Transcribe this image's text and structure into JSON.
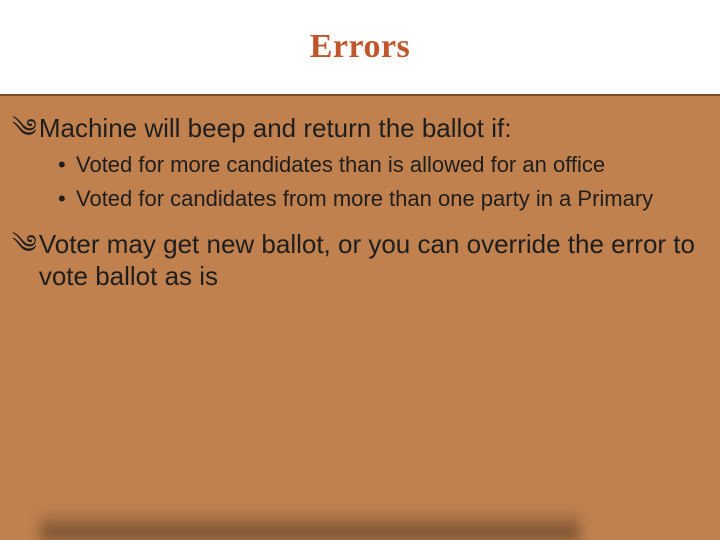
{
  "slide": {
    "title": "Errors",
    "bullets": [
      {
        "text": "Machine will beep and return the ballot if:",
        "sub": [
          "Voted for more candidates than is allowed for an office",
          "Voted for candidates from more than one party in a Primary"
        ]
      },
      {
        "text": "Voter may get new ballot, or you can override the error to vote ballot as is",
        "sub": []
      }
    ],
    "bullet_glyph": "༄",
    "sub_bullet_glyph": "•"
  }
}
